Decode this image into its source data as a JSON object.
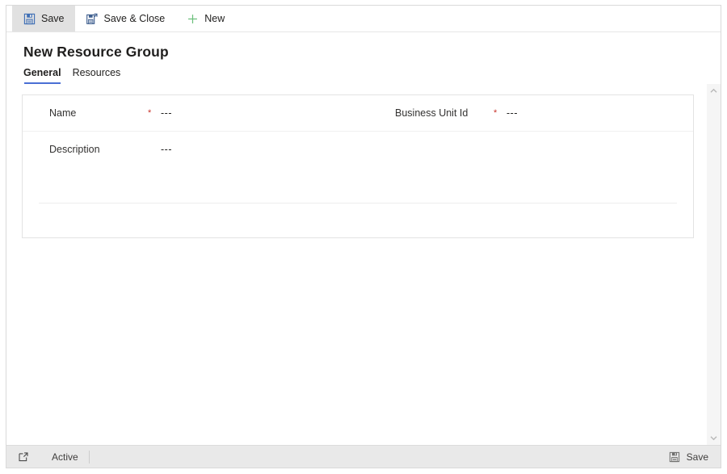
{
  "window": {
    "title": "New Resource Group"
  },
  "command_bar": {
    "buttons": [
      {
        "label": "Save",
        "icon": "save-floppy-icon",
        "state": "active"
      },
      {
        "label": "Save & Close",
        "icon": "save-and-close-icon",
        "state": "normal"
      },
      {
        "label": "New",
        "icon": "plus-icon",
        "state": "normal"
      }
    ]
  },
  "header": {
    "record_title": "New Resource Group"
  },
  "tabs": [
    {
      "label": "General",
      "selected": true
    },
    {
      "label": "Resources",
      "selected": false
    }
  ],
  "form": {
    "fields": [
      {
        "label": "Name",
        "required": "*",
        "value": "---",
        "column": "left"
      },
      {
        "label": "Business Unit Id",
        "required": "*",
        "value": "---",
        "column": "right"
      },
      {
        "label": "Description",
        "required": "",
        "value": "---",
        "column": "left"
      }
    ]
  },
  "scrollbar": {
    "up_arrow_icon": "chevron-up-icon",
    "down_arrow_icon": "chevron-down-icon"
  },
  "status_bar": {
    "popout_icon": "open-in-new-window-icon",
    "state_text": "Active",
    "save_label": "Save",
    "save_icon": "save-floppy-icon"
  },
  "colors": {
    "tab_accent": "#4a6fd4",
    "required_asterisk": "#c8342b",
    "save_icon_blue": "#3f6fb5",
    "new_icon_green": "#6bbf7b",
    "status_bar_bg": "#e9e9e9",
    "command_active_bg": "#e1e1e1"
  }
}
